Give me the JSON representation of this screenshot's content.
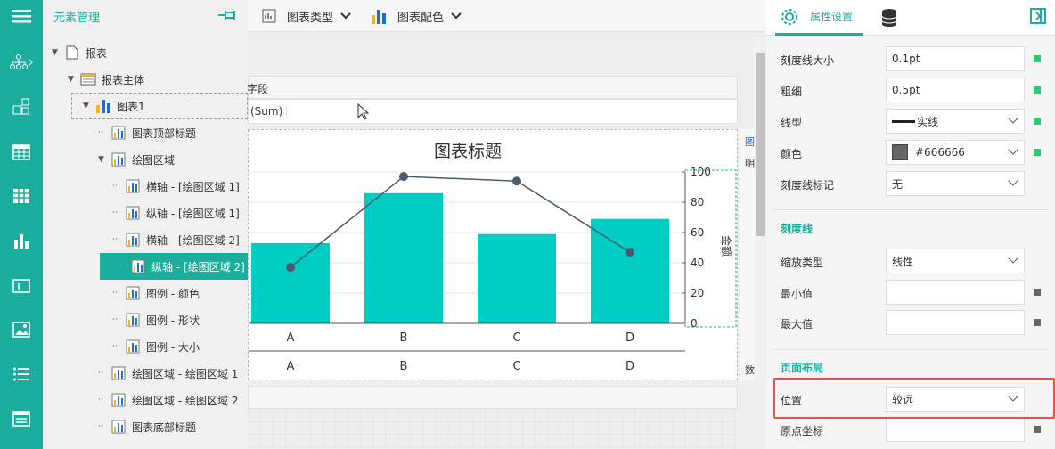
{
  "tree": {
    "title": "元素管理",
    "nodes": [
      {
        "label": "报表"
      },
      {
        "label": "报表主体"
      },
      {
        "label": "图表1"
      },
      {
        "label": "图表顶部标题"
      },
      {
        "label": "绘图区域"
      },
      {
        "label": "横轴 - [绘图区域 1]"
      },
      {
        "label": "纵轴 - [绘图区域 1]"
      },
      {
        "label": "横轴 - [绘图区域 2]"
      },
      {
        "label": "纵轴 - [绘图区域 2]"
      },
      {
        "label": "图例 - 颜色"
      },
      {
        "label": "图例 - 形状"
      },
      {
        "label": "图例 - 大小"
      },
      {
        "label": "绘图区域 - 绘图区域 1"
      },
      {
        "label": "绘图区域 - 绘图区域 2"
      },
      {
        "label": "图表底部标题"
      }
    ]
  },
  "toolbar": {
    "chart_type": "图表类型",
    "chart_color": "图表配色"
  },
  "canvas": {
    "field_header": "字段",
    "sum_label": "(Sum)",
    "side1": "图",
    "side2": "明",
    "side3": "数"
  },
  "chart_data": {
    "type": "bar",
    "title": "图表标题",
    "categories": [
      "A",
      "B",
      "C",
      "D"
    ],
    "series": [
      {
        "values": [
          53,
          86,
          59,
          69
        ]
      },
      {
        "values": [
          37,
          97,
          94,
          47
        ]
      }
    ],
    "y2label": "金额",
    "y2ticks": [
      "0",
      "20",
      "40",
      "60",
      "80",
      "100"
    ],
    "ylim": [
      0,
      100
    ]
  },
  "panel": {
    "tab1": "属性设置",
    "rows1": [
      {
        "label": "刻度线大小",
        "value": "0.1pt"
      },
      {
        "label": "粗细",
        "value": "0.5pt"
      },
      {
        "label": "线型",
        "value": "实线"
      },
      {
        "label": "颜色",
        "value": "#666666"
      },
      {
        "label": "刻度线标记",
        "value": "无"
      }
    ],
    "sec1": "刻度线",
    "rows2": [
      {
        "label": "缩放类型",
        "value": "线性"
      },
      {
        "label": "最小值",
        "value": ""
      },
      {
        "label": "最大值",
        "value": ""
      }
    ],
    "sec2": "页面布局",
    "rows3": [
      {
        "label": "位置",
        "value": "较远"
      },
      {
        "label": "原点坐标",
        "value": ""
      }
    ]
  }
}
